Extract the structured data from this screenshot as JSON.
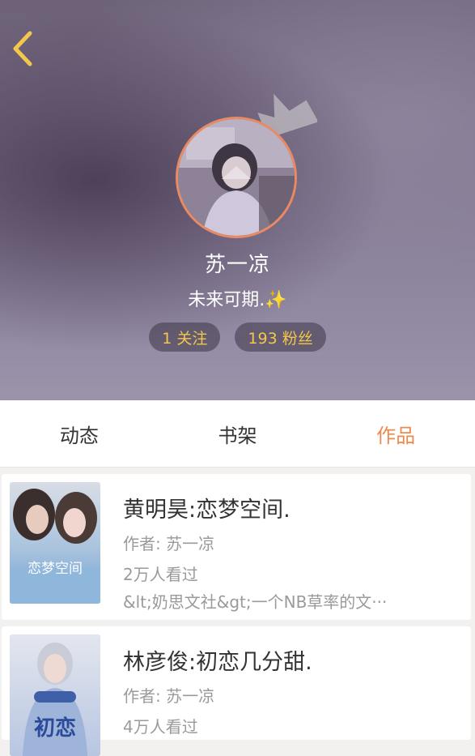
{
  "header": {
    "back_icon": "chevron-left-icon",
    "profile": {
      "name": "苏一凉",
      "bio": "未来可期.✨",
      "follow_label": "1 关注",
      "fans_label": "193 粉丝"
    },
    "colors": {
      "accent": "#ec8a4e",
      "stat_text": "#f3c64e",
      "avatar_border": "#ea8a64"
    }
  },
  "tabs": [
    {
      "label": "动态",
      "active": false
    },
    {
      "label": "书架",
      "active": false
    },
    {
      "label": "作品",
      "active": true
    }
  ],
  "works": [
    {
      "title": "黄明昊:恋梦空间.",
      "author": "作者: 苏一凉",
      "views": "2万人看过",
      "desc": "&lt;奶思文社&gt;一个NB草率的文···",
      "cover_text": "恋梦空间"
    },
    {
      "title": "林彦俊:初恋几分甜.",
      "author": "作者: 苏一凉",
      "views": "4万人看过",
      "desc": "",
      "cover_text": "初恋"
    }
  ]
}
